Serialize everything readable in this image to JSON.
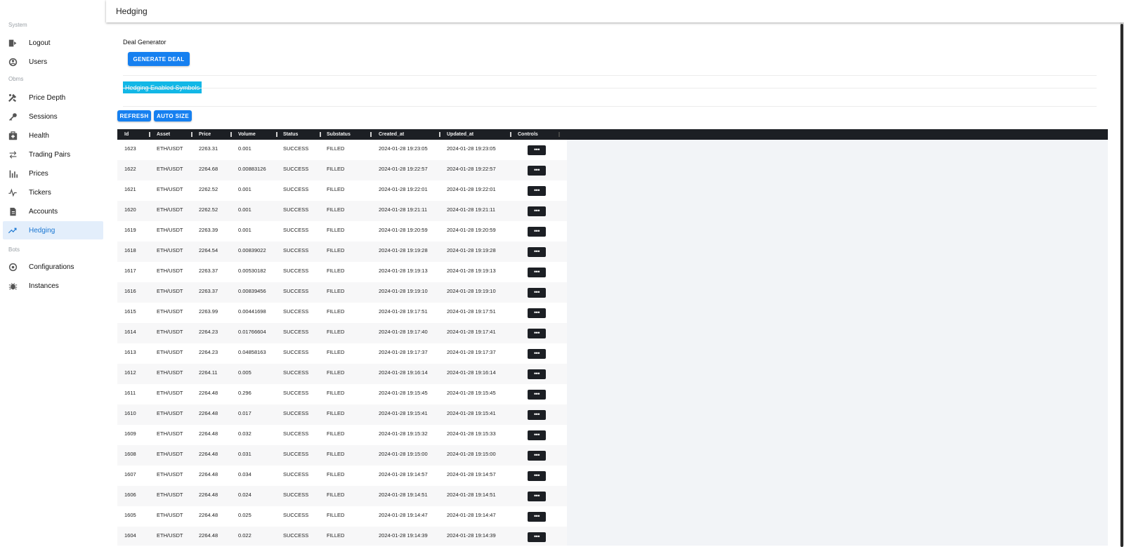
{
  "sidebar": {
    "sections": {
      "system": "System",
      "obms": "Obms",
      "bots": "Bots"
    },
    "items": [
      {
        "label": "Logout",
        "icon": "logout-icon"
      },
      {
        "label": "Users",
        "icon": "users-icon"
      },
      {
        "label": "Price Depth",
        "icon": "tools-icon"
      },
      {
        "label": "Sessions",
        "icon": "key-icon"
      },
      {
        "label": "Health",
        "icon": "medkit-icon"
      },
      {
        "label": "Trading Pairs",
        "icon": "swap-icon"
      },
      {
        "label": "Prices",
        "icon": "bar-chart-icon"
      },
      {
        "label": "Tickers",
        "icon": "pulse-icon"
      },
      {
        "label": "Accounts",
        "icon": "document-icon"
      },
      {
        "label": "Hedging",
        "icon": "trending-up-icon",
        "active": true
      },
      {
        "label": "Configurations",
        "icon": "settings-icon"
      },
      {
        "label": "Instances",
        "icon": "bug-icon"
      }
    ]
  },
  "header": {
    "title": "Hedging"
  },
  "deal_generator": {
    "label": "Deal Generator",
    "button": "GENERATE DEAL"
  },
  "symbols_badge": "Hedging Enabled Symbols",
  "toolbar": {
    "refresh": "REFRESH",
    "auto_size": "AUTO SIZE"
  },
  "table": {
    "columns": [
      "Id",
      "Asset",
      "Price",
      "Volume",
      "Status",
      "Substatus",
      "Created_at",
      "Updated_at",
      "Controls"
    ],
    "control_label": "•••",
    "rows": [
      [
        "1623",
        "ETH/USDT",
        "2263.31",
        "0.001",
        "SUCCESS",
        "FILLED",
        "2024-01-28 19:23:05",
        "2024-01-28 19:23:05"
      ],
      [
        "1622",
        "ETH/USDT",
        "2264.68",
        "0.00883126",
        "SUCCESS",
        "FILLED",
        "2024-01-28 19:22:57",
        "2024-01-28 19:22:57"
      ],
      [
        "1621",
        "ETH/USDT",
        "2262.52",
        "0.001",
        "SUCCESS",
        "FILLED",
        "2024-01-28 19:22:01",
        "2024-01-28 19:22:01"
      ],
      [
        "1620",
        "ETH/USDT",
        "2262.52",
        "0.001",
        "SUCCESS",
        "FILLED",
        "2024-01-28 19:21:11",
        "2024-01-28 19:21:11"
      ],
      [
        "1619",
        "ETH/USDT",
        "2263.39",
        "0.001",
        "SUCCESS",
        "FILLED",
        "2024-01-28 19:20:59",
        "2024-01-28 19:20:59"
      ],
      [
        "1618",
        "ETH/USDT",
        "2264.54",
        "0.00839022",
        "SUCCESS",
        "FILLED",
        "2024-01-28 19:19:28",
        "2024-01-28 19:19:28"
      ],
      [
        "1617",
        "ETH/USDT",
        "2263.37",
        "0.00530182",
        "SUCCESS",
        "FILLED",
        "2024-01-28 19:19:13",
        "2024-01-28 19:19:13"
      ],
      [
        "1616",
        "ETH/USDT",
        "2263.37",
        "0.00839456",
        "SUCCESS",
        "FILLED",
        "2024-01-28 19:19:10",
        "2024-01-28 19:19:10"
      ],
      [
        "1615",
        "ETH/USDT",
        "2263.99",
        "0.00441698",
        "SUCCESS",
        "FILLED",
        "2024-01-28 19:17:51",
        "2024-01-28 19:17:51"
      ],
      [
        "1614",
        "ETH/USDT",
        "2264.23",
        "0.01766604",
        "SUCCESS",
        "FILLED",
        "2024-01-28 19:17:40",
        "2024-01-28 19:17:41"
      ],
      [
        "1613",
        "ETH/USDT",
        "2264.23",
        "0.04858163",
        "SUCCESS",
        "FILLED",
        "2024-01-28 19:17:37",
        "2024-01-28 19:17:37"
      ],
      [
        "1612",
        "ETH/USDT",
        "2264.11",
        "0.005",
        "SUCCESS",
        "FILLED",
        "2024-01-28 19:16:14",
        "2024-01-28 19:16:14"
      ],
      [
        "1611",
        "ETH/USDT",
        "2264.48",
        "0.296",
        "SUCCESS",
        "FILLED",
        "2024-01-28 19:15:45",
        "2024-01-28 19:15:45"
      ],
      [
        "1610",
        "ETH/USDT",
        "2264.48",
        "0.017",
        "SUCCESS",
        "FILLED",
        "2024-01-28 19:15:41",
        "2024-01-28 19:15:41"
      ],
      [
        "1609",
        "ETH/USDT",
        "2264.48",
        "0.032",
        "SUCCESS",
        "FILLED",
        "2024-01-28 19:15:32",
        "2024-01-28 19:15:33"
      ],
      [
        "1608",
        "ETH/USDT",
        "2264.48",
        "0.031",
        "SUCCESS",
        "FILLED",
        "2024-01-28 19:15:00",
        "2024-01-28 19:15:00"
      ],
      [
        "1607",
        "ETH/USDT",
        "2264.48",
        "0.034",
        "SUCCESS",
        "FILLED",
        "2024-01-28 19:14:57",
        "2024-01-28 19:14:57"
      ],
      [
        "1606",
        "ETH/USDT",
        "2264.48",
        "0.024",
        "SUCCESS",
        "FILLED",
        "2024-01-28 19:14:51",
        "2024-01-28 19:14:51"
      ],
      [
        "1605",
        "ETH/USDT",
        "2264.48",
        "0.025",
        "SUCCESS",
        "FILLED",
        "2024-01-28 19:14:47",
        "2024-01-28 19:14:47"
      ],
      [
        "1604",
        "ETH/USDT",
        "2264.48",
        "0.022",
        "SUCCESS",
        "FILLED",
        "2024-01-28 19:14:39",
        "2024-01-28 19:14:39"
      ]
    ]
  },
  "colors": {
    "accent": "#1680f0",
    "active_bg": "#e3eefb",
    "badge": "#12b7e6",
    "grid_header": "#1c1f24"
  }
}
